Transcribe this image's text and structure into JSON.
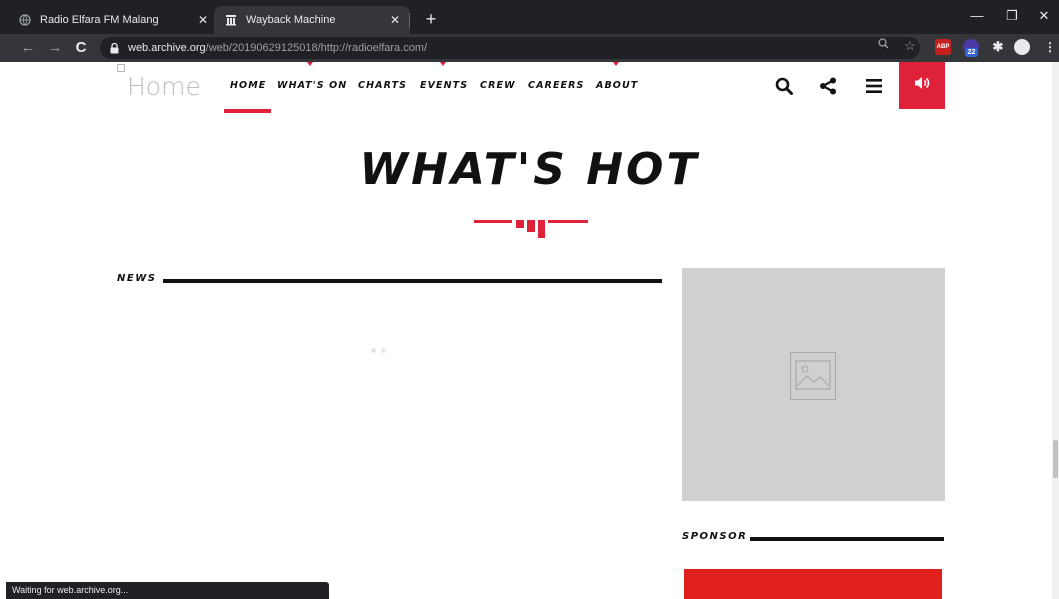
{
  "browser": {
    "tabs": [
      {
        "title": "Radio Elfara FM Malang",
        "active": false
      },
      {
        "title": "Wayback Machine",
        "active": true
      }
    ],
    "url": {
      "host": "web.archive.org",
      "path": "/web/20190629125018/http://radioelfara.com/"
    },
    "extension_badges": {
      "abp": "ABP",
      "count": "22"
    },
    "status_text": "Waiting for web.archive.org..."
  },
  "site": {
    "logo_alt": "Home",
    "nav": [
      "HOME",
      "WHAT'S ON",
      "CHARTS",
      "EVENTS",
      "CREW",
      "CAREERS",
      "ABOUT"
    ],
    "active_nav": "HOME",
    "accent_color": "#e0213a",
    "header_icons": [
      "search-icon",
      "share-icon",
      "menu-icon",
      "volume-icon"
    ]
  },
  "main": {
    "heading": "WHAT'S HOT",
    "news_label": "NEWS",
    "sponsor_label": "SPONSOR"
  }
}
